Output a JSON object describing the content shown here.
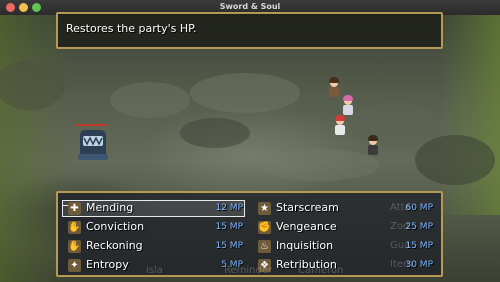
{
  "window": {
    "title": "Sword & Soul"
  },
  "help": {
    "text": "Restores the party's HP."
  },
  "skills": [
    {
      "name": "Mending",
      "cost": "12 MP",
      "icon": "heal-icon",
      "color": "#c8a55a"
    },
    {
      "name": "Starscream",
      "cost": "60 MP",
      "icon": "star-icon",
      "color": "#c8a55a"
    },
    {
      "name": "Conviction",
      "cost": "15 MP",
      "icon": "hand-icon",
      "color": "#c8a55a"
    },
    {
      "name": "Vengeance",
      "cost": "25 MP",
      "icon": "fist-icon",
      "color": "#c8a55a"
    },
    {
      "name": "Reckoning",
      "cost": "15 MP",
      "icon": "hand-icon",
      "color": "#c8a55a"
    },
    {
      "name": "Inquisition",
      "cost": "15 MP",
      "icon": "flame-icon",
      "color": "#c8a55a"
    },
    {
      "name": "Entropy",
      "cost": "5 MP",
      "icon": "swirl-icon",
      "color": "#c8a55a"
    },
    {
      "name": "Retribution",
      "cost": "30 MP",
      "icon": "book-icon",
      "color": "#c8a55a"
    }
  ],
  "ghost_commands": [
    "Atta",
    "Zod",
    "Gua",
    "Item"
  ],
  "ghost_party": [
    "isla",
    "Reminder",
    "Cameron"
  ],
  "colors": {
    "frame": "#b49a55",
    "mp": "#7fb6ff",
    "text": "#ffffff"
  }
}
